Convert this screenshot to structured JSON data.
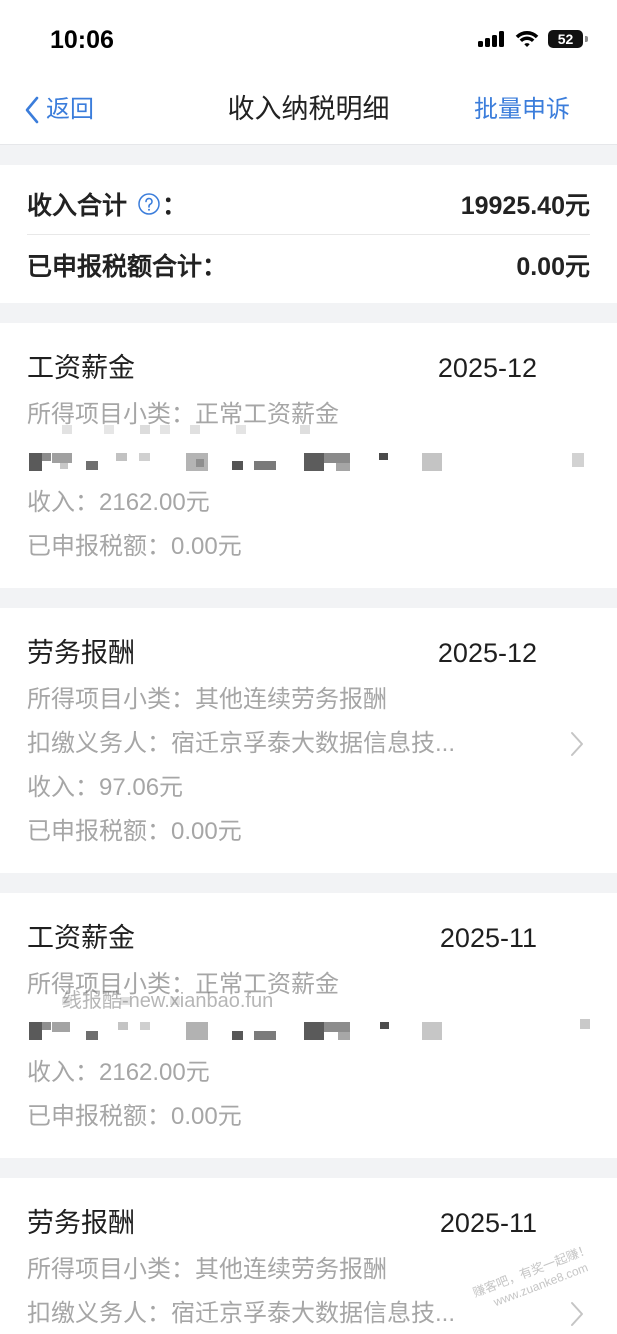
{
  "status_bar": {
    "time": "10:06",
    "battery_level": "52",
    "icons": [
      "cellular-signal-icon",
      "wifi-icon",
      "battery-icon"
    ]
  },
  "nav": {
    "back_icon": "chevron-left-icon",
    "back_label": "返回",
    "title": "收入纳税明细",
    "action_label": "批量申诉"
  },
  "summary": {
    "income_total_label": "收入合计",
    "help_icon": "question-circle-icon",
    "colon": "：",
    "income_total_value": "19925.40元",
    "tax_total_label": "已申报税额合计：",
    "tax_total_value": "0.00元"
  },
  "records": [
    {
      "income_type": "工资薪金",
      "period": "2025-12",
      "subcategory_label": "所得项目小类：",
      "subcategory": "正常工资薪金",
      "income_label": "收入：",
      "income": "2162.00元",
      "tax_label": "已申报税额：",
      "tax": "0.00元"
    },
    {
      "income_type": "劳务报酬",
      "period": "2025-12",
      "subcategory_label": "所得项目小类：",
      "subcategory": "其他连续劳务报酬",
      "withholding_agent_label": "扣缴义务人：",
      "withholding_agent": "宿迁京孚泰大数据信息技...",
      "income_label": "收入：",
      "income": "97.06元",
      "tax_label": "已申报税额：",
      "tax": "0.00元"
    },
    {
      "income_type": "工资薪金",
      "period": "2025-11",
      "subcategory_label": "所得项目小类：",
      "subcategory": "正常工资薪金",
      "income_label": "收入：",
      "income": "2162.00元",
      "tax_label": "已申报税额：",
      "tax": "0.00元"
    },
    {
      "income_type": "劳务报酬",
      "period": "2025-11",
      "subcategory_label": "所得项目小类：",
      "subcategory": "其他连续劳务报酬",
      "withholding_agent_label": "扣缴义务人：",
      "withholding_agent": "宿迁京孚泰大数据信息技..."
    }
  ],
  "row_icon": "chevron-right-icon",
  "watermarks": {
    "xianbao": "线报酷-new.xianbao.fun",
    "zuanke_slogan": "赚客吧，有奖一起赚！",
    "zuanke_url": "www.zuanke8.com"
  },
  "colors": {
    "accent_blue": "#3b7ddb",
    "text_primary": "#1f1f1f",
    "text_secondary": "#a6a6a6",
    "page_background": "#f2f3f5",
    "card_background": "#ffffff"
  }
}
